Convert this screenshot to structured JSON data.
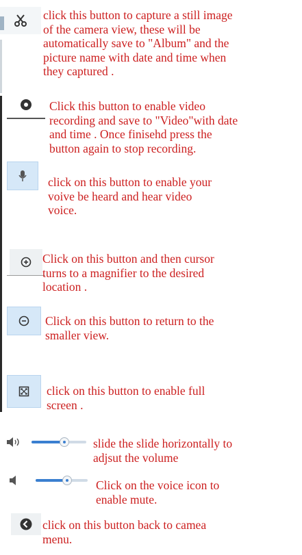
{
  "items": [
    {
      "icon": "scissors-icon",
      "text": "click this button to capture a still image\nof the camera view, these will be\nautomatically save to \"Album\" and the\npicture name with date and time when\nthey captured ."
    },
    {
      "icon": "record-icon",
      "text": "Click this button to enable video\nrecording and save to \"Video\"with date\nand time . Once finisehd press the\nbutton again to stop recording."
    },
    {
      "icon": "microphone-icon",
      "text": "click on this button to enable your\nvoive be heard and hear video\nvoice."
    },
    {
      "icon": "zoom-in-icon",
      "text": "Click on this button and then cursor\nturns to a magnifier to the desired\nlocation ."
    },
    {
      "icon": "zoom-out-icon",
      "text": "Click on this button to return to the\nsmaller view."
    },
    {
      "icon": "fullscreen-icon",
      "text": "click on this button to enable full\nscreen ."
    },
    {
      "icon": "speaker-icon",
      "text": "slide the slide horizontally to\nadjsut the volume",
      "slider_level": 0.6
    },
    {
      "icon": "speaker-mute-icon",
      "text": "Click on the voice icon  to\nenable mute.",
      "slider_level": 0.6
    },
    {
      "icon": "back-arrow-icon",
      "text": "click on this button back to camea\nmenu."
    }
  ],
  "colors": {
    "text": "#cc1f1f",
    "icon": "#333333",
    "button_bg": "#d6e8f8",
    "slider_fill": "#3a7fd0"
  }
}
